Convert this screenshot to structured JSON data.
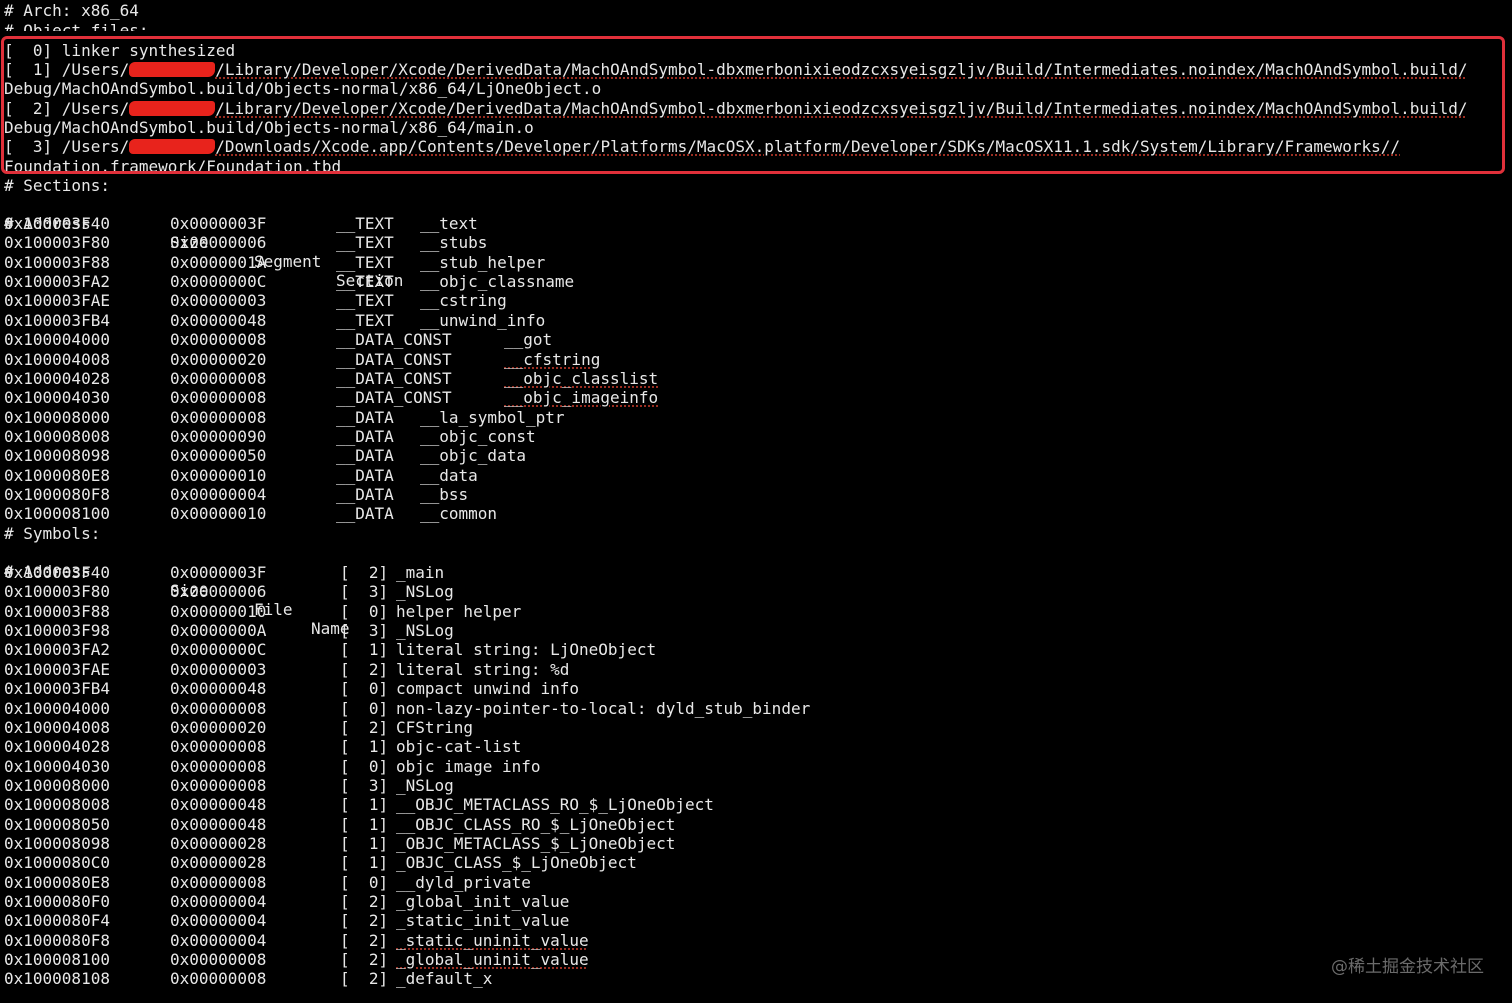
{
  "header": {
    "arch_line": "# Arch: x86_64",
    "object_files_line": "# Object files:"
  },
  "object_files": [
    {
      "text1": "[  0] linker synthesized"
    },
    {
      "prefix": "[  1] /Users/",
      "suffix": "/Library/Developer/Xcode/DerivedData/MachOAndSymbol-dbxmerbonixieodzcxsyeisgzljv/Build/Intermediates.noindex/MachOAndSymbol.build/",
      "cont": "Debug/MachOAndSymbol.build/Objects-normal/x86_64/LjOneObject.o"
    },
    {
      "prefix": "[  2] /Users/",
      "suffix": "/Library/Developer/Xcode/DerivedData/MachOAndSymbol-dbxmerbonixieodzcxsyeisgzljv/Build/Intermediates.noindex/MachOAndSymbol.build/",
      "cont": "Debug/MachOAndSymbol.build/Objects-normal/x86_64/main.o"
    },
    {
      "prefix": "[  3] /Users/",
      "suffix": "/Downloads/Xcode.app/Contents/Developer/Platforms/MacOSX.platform/Developer/SDKs/MacOSX11.1.sdk/System/Library/Frameworks//",
      "cont": "Foundation.framework/Foundation.tbd"
    }
  ],
  "sections": {
    "title": "# Sections:",
    "col_address": "# Address",
    "col_size": "Size",
    "col_segment": "Segment",
    "col_section": "Section",
    "rows": [
      {
        "addr": "0x100003F40",
        "size": "0x0000003F",
        "seg": "__TEXT",
        "sect": "__text"
      },
      {
        "addr": "0x100003F80",
        "size": "0x00000006",
        "seg": "__TEXT",
        "sect": "__stubs"
      },
      {
        "addr": "0x100003F88",
        "size": "0x0000001A",
        "seg": "__TEXT",
        "sect": "__stub_helper"
      },
      {
        "addr": "0x100003FA2",
        "size": "0x0000000C",
        "seg": "__TEXT",
        "sect": "__objc_classname"
      },
      {
        "addr": "0x100003FAE",
        "size": "0x00000003",
        "seg": "__TEXT",
        "sect": "__cstring"
      },
      {
        "addr": "0x100003FB4",
        "size": "0x00000048",
        "seg": "__TEXT",
        "sect": "__unwind_info"
      },
      {
        "addr": "0x100004000",
        "size": "0x00000008",
        "seg": "__DATA_CONST",
        "sect": "__got"
      },
      {
        "addr": "0x100004008",
        "size": "0x00000020",
        "seg": "__DATA_CONST",
        "sect": "__cfstring"
      },
      {
        "addr": "0x100004028",
        "size": "0x00000008",
        "seg": "__DATA_CONST",
        "sect": "__objc_classlist"
      },
      {
        "addr": "0x100004030",
        "size": "0x00000008",
        "seg": "__DATA_CONST",
        "sect": "__objc_imageinfo"
      },
      {
        "addr": "0x100008000",
        "size": "0x00000008",
        "seg": "__DATA",
        "sect": "__la_symbol_ptr"
      },
      {
        "addr": "0x100008008",
        "size": "0x00000090",
        "seg": "__DATA",
        "sect": "__objc_const"
      },
      {
        "addr": "0x100008098",
        "size": "0x00000050",
        "seg": "__DATA",
        "sect": "__objc_data"
      },
      {
        "addr": "0x1000080E8",
        "size": "0x00000010",
        "seg": "__DATA",
        "sect": "__data"
      },
      {
        "addr": "0x1000080F8",
        "size": "0x00000004",
        "seg": "__DATA",
        "sect": "__bss"
      },
      {
        "addr": "0x100008100",
        "size": "0x00000010",
        "seg": "__DATA",
        "sect": "__common"
      }
    ]
  },
  "symbols": {
    "title": "# Symbols:",
    "col_address": "# Address",
    "col_size": "Size",
    "col_file": "File",
    "col_name": "Name",
    "rows": [
      {
        "addr": "0x100003F40",
        "size": "0x0000003F",
        "file": "[  2]",
        "name": "_main"
      },
      {
        "addr": "0x100003F80",
        "size": "0x00000006",
        "file": "[  3]",
        "name": "_NSLog"
      },
      {
        "addr": "0x100003F88",
        "size": "0x00000010",
        "file": "[  0]",
        "name": "helper helper"
      },
      {
        "addr": "0x100003F98",
        "size": "0x0000000A",
        "file": "[  3]",
        "name": "_NSLog"
      },
      {
        "addr": "0x100003FA2",
        "size": "0x0000000C",
        "file": "[  1]",
        "name": "literal string: LjOneObject"
      },
      {
        "addr": "0x100003FAE",
        "size": "0x00000003",
        "file": "[  2]",
        "name": "literal string: %d"
      },
      {
        "addr": "0x100003FB4",
        "size": "0x00000048",
        "file": "[  0]",
        "name": "compact unwind info"
      },
      {
        "addr": "0x100004000",
        "size": "0x00000008",
        "file": "[  0]",
        "name": "non-lazy-pointer-to-local: dyld_stub_binder"
      },
      {
        "addr": "0x100004008",
        "size": "0x00000020",
        "file": "[  2]",
        "name": "CFString"
      },
      {
        "addr": "0x100004028",
        "size": "0x00000008",
        "file": "[  1]",
        "name": "objc-cat-list"
      },
      {
        "addr": "0x100004030",
        "size": "0x00000008",
        "file": "[  0]",
        "name": "objc image info"
      },
      {
        "addr": "0x100008000",
        "size": "0x00000008",
        "file": "[  3]",
        "name": "_NSLog"
      },
      {
        "addr": "0x100008008",
        "size": "0x00000048",
        "file": "[  1]",
        "name": "__OBJC_METACLASS_RO_$_LjOneObject"
      },
      {
        "addr": "0x100008050",
        "size": "0x00000048",
        "file": "[  1]",
        "name": "__OBJC_CLASS_RO_$_LjOneObject"
      },
      {
        "addr": "0x100008098",
        "size": "0x00000028",
        "file": "[  1]",
        "name": "_OBJC_METACLASS_$_LjOneObject"
      },
      {
        "addr": "0x1000080C0",
        "size": "0x00000028",
        "file": "[  1]",
        "name": "_OBJC_CLASS_$_LjOneObject"
      },
      {
        "addr": "0x1000080E8",
        "size": "0x00000008",
        "file": "[  0]",
        "name": "__dyld_private"
      },
      {
        "addr": "0x1000080F0",
        "size": "0x00000004",
        "file": "[  2]",
        "name": "_global_init_value"
      },
      {
        "addr": "0x1000080F4",
        "size": "0x00000004",
        "file": "[  2]",
        "name": "_static_init_value"
      },
      {
        "addr": "0x1000080F8",
        "size": "0x00000004",
        "file": "[  2]",
        "name": "_static_uninit_value"
      },
      {
        "addr": "0x100008100",
        "size": "0x00000008",
        "file": "[  2]",
        "name": "_global_uninit_value"
      },
      {
        "addr": "0x100008108",
        "size": "0x00000008",
        "file": "[  2]",
        "name": "_default_x"
      }
    ]
  },
  "watermark": "@稀土掘金技术社区",
  "colors": {
    "background": "#000000",
    "text": "#e8e8e8",
    "highlight_border": "#e0303a",
    "redaction": "#e8231c",
    "spellcheck_underline": "#c0392b",
    "watermark": "#6b6b6b"
  }
}
